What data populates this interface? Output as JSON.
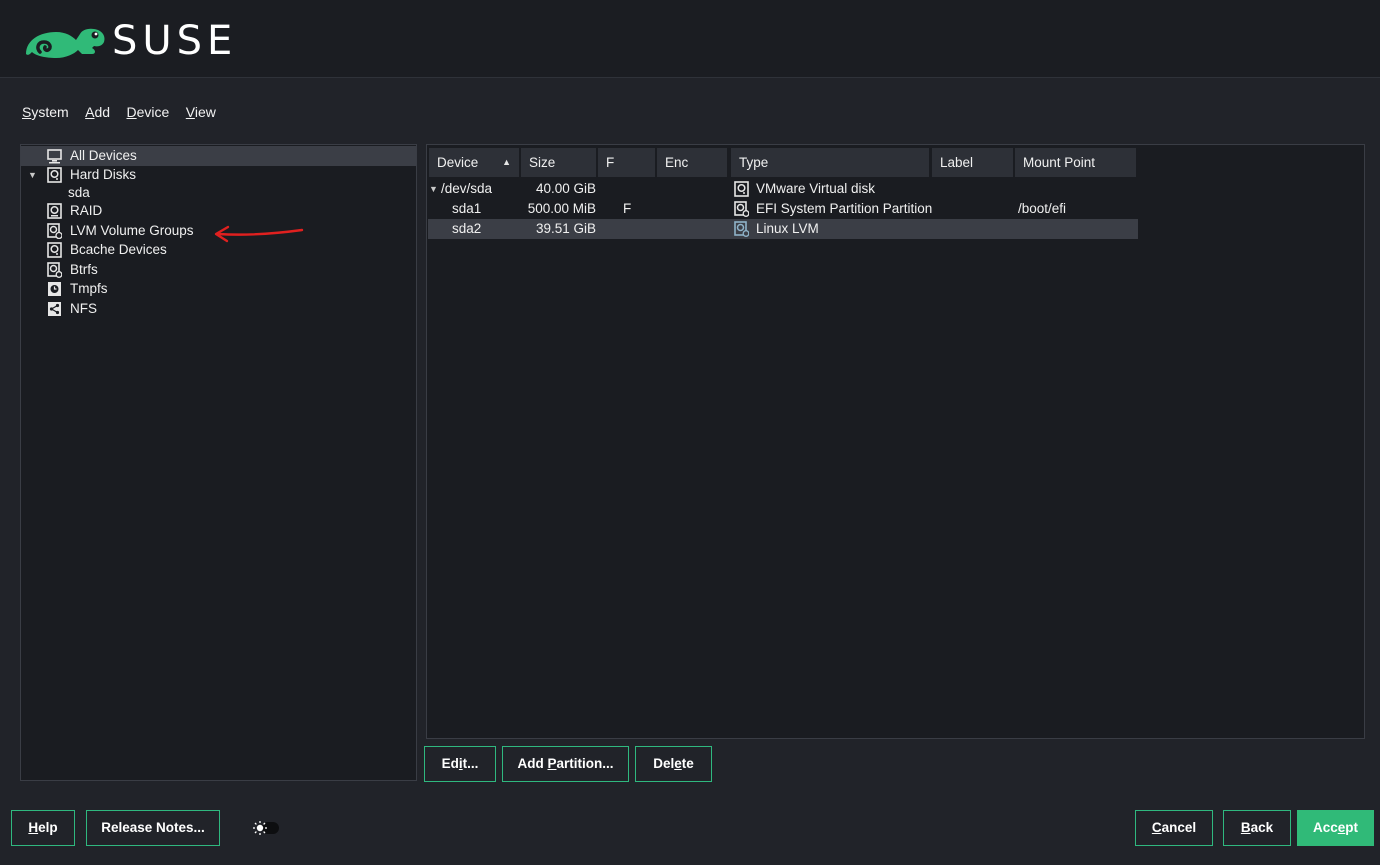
{
  "header": {
    "brand": "SUSE",
    "logo_icon": "chameleon-logo-icon",
    "brand_color": "#30ba78"
  },
  "menu": [
    {
      "before": "",
      "mnemonic": "S",
      "after": "ystem"
    },
    {
      "before": "",
      "mnemonic": "A",
      "after": "dd"
    },
    {
      "before": "",
      "mnemonic": "D",
      "after": "evice"
    },
    {
      "before": "",
      "mnemonic": "V",
      "after": "iew"
    }
  ],
  "tree": {
    "items": [
      {
        "label": "All Devices",
        "icon": "monitor-icon",
        "selected": true
      },
      {
        "label": "Hard Disks",
        "icon": "disk-icon",
        "expanded": true
      },
      {
        "label": "sda",
        "icon": ""
      },
      {
        "label": "RAID",
        "icon": "raid-icon"
      },
      {
        "label": "LVM Volume Groups",
        "icon": "lvm-icon"
      },
      {
        "label": "Bcache Devices",
        "icon": "disk-icon"
      },
      {
        "label": "Btrfs",
        "icon": "btrfs-icon"
      },
      {
        "label": "Tmpfs",
        "icon": "tmpfs-icon"
      },
      {
        "label": "NFS",
        "icon": "nfs-share-icon"
      }
    ]
  },
  "table": {
    "columns": [
      "Device",
      "Size",
      "F",
      "Enc",
      "Type",
      "Label",
      "Mount Point"
    ],
    "sort_column": "Device",
    "rows": [
      {
        "device": "/dev/sda",
        "size": "40.00 GiB",
        "f": "",
        "enc": "",
        "type": "VMware Virtual disk",
        "label": "",
        "mount": "",
        "type_icon": "disk-icon",
        "expanded": true,
        "selected": false
      },
      {
        "device": "sda1",
        "size": "500.00 MiB",
        "f": "F",
        "enc": "",
        "type": "EFI System Partition Partition",
        "label": "",
        "mount": "/boot/efi",
        "type_icon": "partition-icon",
        "selected": false
      },
      {
        "device": "sda2",
        "size": "39.51 GiB",
        "f": "",
        "enc": "",
        "type": "Linux LVM",
        "label": "",
        "mount": "",
        "type_icon": "lvm-partition-icon",
        "selected": true
      }
    ]
  },
  "actions": {
    "edit": {
      "before": "Ed",
      "mnemonic": "i",
      "after": "t..."
    },
    "add_partition": {
      "before": "Add ",
      "mnemonic": "P",
      "after": "artition..."
    },
    "delete": {
      "before": "Del",
      "mnemonic": "e",
      "after": "te"
    }
  },
  "footer": {
    "help": {
      "before": "",
      "mnemonic": "H",
      "after": "elp"
    },
    "release_notes": {
      "before": "Release Notes...",
      "mnemonic": "",
      "after": ""
    },
    "cancel": {
      "before": "",
      "mnemonic": "C",
      "after": "ancel"
    },
    "back": {
      "before": "",
      "mnemonic": "B",
      "after": "ack"
    },
    "accept": {
      "before": "Acc",
      "mnemonic": "e",
      "after": "pt"
    },
    "theme_toggle_icon": "sun-toggle-icon"
  },
  "annotation": {
    "icon": "red-arrow-annotation-icon",
    "color": "#e0201f"
  }
}
